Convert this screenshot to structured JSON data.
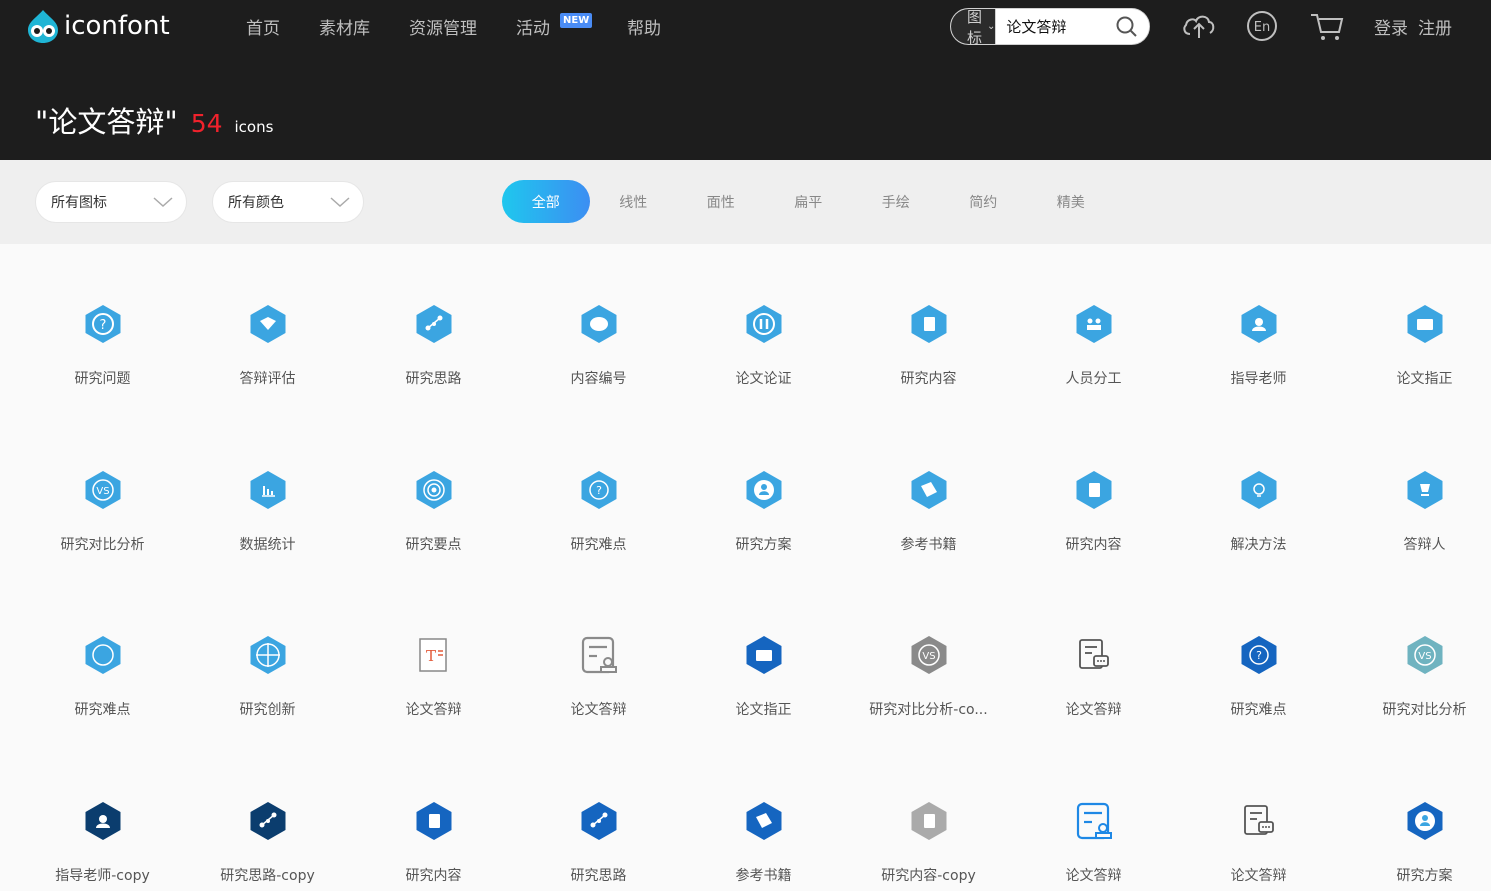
{
  "app": {
    "logo_text": "iconfont"
  },
  "nav": [
    "首页",
    "素材库",
    "资源管理",
    "活动",
    "帮助"
  ],
  "nav_badge": "NEW",
  "search": {
    "type_label": "图标",
    "query": "论文答辩"
  },
  "header_icons": [
    "upload-cloud-icon",
    "language-icon",
    "cart-icon"
  ],
  "lang_label": "En",
  "auth": {
    "login": "登录",
    "register": "注册"
  },
  "result": {
    "title": "\"论文答辩\"",
    "count": "54",
    "unit": "icons"
  },
  "filters": {
    "icon_type": "所有图标",
    "color": "所有颜色"
  },
  "tabs": [
    "全部",
    "线性",
    "面性",
    "扁平",
    "手绘",
    "简约",
    "精美"
  ],
  "active_tab": "全部",
  "icons": [
    {
      "label": "研究问题",
      "color": "#3ba5e1",
      "glyph": "question"
    },
    {
      "label": "答辩评估",
      "color": "#3ba5e1",
      "glyph": "book"
    },
    {
      "label": "研究思路",
      "color": "#3ba5e1",
      "glyph": "nodes"
    },
    {
      "label": "内容编号",
      "color": "#3ba5e1",
      "glyph": "chat"
    },
    {
      "label": "论文论证",
      "color": "#3ba5e1",
      "glyph": "pause"
    },
    {
      "label": "研究内容",
      "color": "#3ba5e1",
      "glyph": "doc"
    },
    {
      "label": "人员分工",
      "color": "#3ba5e1",
      "glyph": "people"
    },
    {
      "label": "指导老师",
      "color": "#3ba5e1",
      "glyph": "person"
    },
    {
      "label": "论文指正",
      "color": "#3ba5e1",
      "glyph": "folder"
    },
    {
      "label": "研究对比分析",
      "color": "#3ba5e1",
      "glyph": "vs"
    },
    {
      "label": "数据统计",
      "color": "#3ba5e1",
      "glyph": "chart"
    },
    {
      "label": "研究要点",
      "color": "#3ba5e1",
      "glyph": "target"
    },
    {
      "label": "研究难点",
      "color": "#3ba5e1",
      "glyph": "q2"
    },
    {
      "label": "研究方案",
      "color": "#3ba5e1",
      "glyph": "person2"
    },
    {
      "label": "参考书籍",
      "color": "#3ba5e1",
      "glyph": "book2"
    },
    {
      "label": "研究内容",
      "color": "#3ba5e1",
      "glyph": "doc"
    },
    {
      "label": "解决方法",
      "color": "#3ba5e1",
      "glyph": "bulb"
    },
    {
      "label": "答辩人",
      "color": "#3ba5e1",
      "glyph": "cup"
    },
    {
      "label": "研究难点",
      "color": "#3ba5e1",
      "glyph": "circle"
    },
    {
      "label": "研究创新",
      "color": "#3ba5e1",
      "glyph": "cross"
    },
    {
      "label": "论文答辩",
      "color": "#e35b3b",
      "glyph": "tdoc"
    },
    {
      "label": "论文答辩",
      "color": "#8a8a8a",
      "glyph": "form"
    },
    {
      "label": "论文指正",
      "color": "#1565c0",
      "glyph": "folder"
    },
    {
      "label": "研究对比分析-co...",
      "color": "#8a8a8a",
      "glyph": "vs"
    },
    {
      "label": "论文答辩",
      "color": "#555555",
      "glyph": "docchat"
    },
    {
      "label": "研究难点",
      "color": "#1565c0",
      "glyph": "q2"
    },
    {
      "label": "研究对比分析",
      "color": "#6fb3c0",
      "glyph": "vs"
    },
    {
      "label": "指导老师-copy",
      "color": "#0b3d6e",
      "glyph": "person"
    },
    {
      "label": "研究思路-copy",
      "color": "#0b3d6e",
      "glyph": "nodes"
    },
    {
      "label": "研究内容",
      "color": "#1565c0",
      "glyph": "doc"
    },
    {
      "label": "研究思路",
      "color": "#1565c0",
      "glyph": "nodes"
    },
    {
      "label": "参考书籍",
      "color": "#1565c0",
      "glyph": "book2"
    },
    {
      "label": "研究内容-copy",
      "color": "#aaaaaa",
      "glyph": "doc"
    },
    {
      "label": "论文答辩",
      "color": "#1e88e5",
      "glyph": "form"
    },
    {
      "label": "论文答辩",
      "color": "#555555",
      "glyph": "docchat"
    },
    {
      "label": "研究方案",
      "color": "#1565c0",
      "glyph": "person2"
    }
  ]
}
